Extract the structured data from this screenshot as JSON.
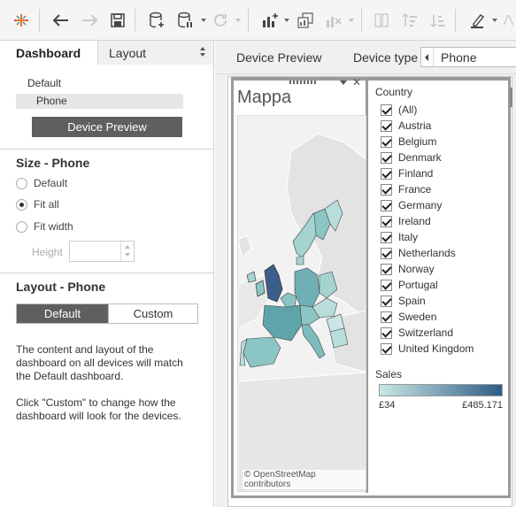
{
  "left_panel": {
    "tabs": [
      {
        "label": "Dashboard",
        "active": true
      },
      {
        "label": "Layout",
        "active": false
      }
    ],
    "devices": {
      "default": "Default",
      "selected": "Phone"
    },
    "device_preview_button": "Device Preview",
    "size_section": {
      "title": "Size - Phone",
      "options": [
        {
          "label": "Default",
          "selected": false
        },
        {
          "label": "Fit all",
          "selected": true
        },
        {
          "label": "Fit width",
          "selected": false
        }
      ],
      "height_label": "Height",
      "height_value": ""
    },
    "layout_section": {
      "title": "Layout - Phone",
      "segments": [
        {
          "label": "Default",
          "selected": true
        },
        {
          "label": "Custom",
          "selected": false
        }
      ],
      "description_1": "The content and layout of the dashboard on all devices will match the Default dashboard.",
      "description_2": "Click \"Custom\" to change how the dashboard will look for the devices."
    }
  },
  "right_panel": {
    "device_preview_tab": "Device Preview",
    "device_type_label": "Device type",
    "device_type_value": "Phone",
    "map": {
      "title": "Mappa",
      "credit": "© OpenStreetMap contributors"
    },
    "country_filter": {
      "title": "Country",
      "items": [
        {
          "label": "(All)",
          "checked": true
        },
        {
          "label": "Austria",
          "checked": true
        },
        {
          "label": "Belgium",
          "checked": true
        },
        {
          "label": "Denmark",
          "checked": true
        },
        {
          "label": "Finland",
          "checked": true
        },
        {
          "label": "France",
          "checked": true
        },
        {
          "label": "Germany",
          "checked": true
        },
        {
          "label": "Ireland",
          "checked": true
        },
        {
          "label": "Italy",
          "checked": true
        },
        {
          "label": "Netherlands",
          "checked": true
        },
        {
          "label": "Norway",
          "checked": true
        },
        {
          "label": "Portugal",
          "checked": true
        },
        {
          "label": "Spain",
          "checked": true
        },
        {
          "label": "Sweden",
          "checked": true
        },
        {
          "label": "Switzerland",
          "checked": true
        },
        {
          "label": "United Kingdom",
          "checked": true
        }
      ]
    },
    "legend": {
      "title": "Sales",
      "min": "£34",
      "max": "£485.171",
      "color_low": "#c9e6e4",
      "color_high": "#2f5d86"
    }
  },
  "colors": {
    "toolbar_bg": "#f5f5f5",
    "selected_button": "#5f5f5f",
    "map_dark": "#3b5f8a",
    "map_mid": "#5fa3ab",
    "map_light": "#bfe0dc"
  }
}
